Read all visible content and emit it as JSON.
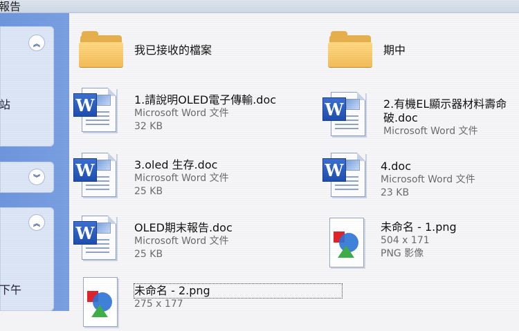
{
  "window": {
    "title_fragment": "報告"
  },
  "task_pane": {
    "panels": [
      {
        "text": "站",
        "collapse_icon": "up"
      },
      {
        "text": "",
        "collapse_icon": "down"
      },
      {
        "text": "下午",
        "collapse_icon": "up"
      }
    ]
  },
  "files": [
    {
      "type": "folder",
      "icon": "folder-icon",
      "name": "我已接收的檔案"
    },
    {
      "type": "folder",
      "icon": "folder-icon",
      "name": "期中"
    },
    {
      "type": "doc",
      "icon": "word-doc-icon",
      "name": "1.請說明OLED電子傳輸.doc",
      "kind": "Microsoft Word 文件",
      "size": "32 KB"
    },
    {
      "type": "doc",
      "icon": "word-doc-icon",
      "name": "2.有機EL顯示器材料壽命",
      "name2": "破.doc",
      "kind": "Microsoft Word 文件",
      "size": ""
    },
    {
      "type": "doc",
      "icon": "word-doc-icon",
      "name": "3.oled 生存.doc",
      "kind": "Microsoft Word 文件",
      "size": "25 KB"
    },
    {
      "type": "doc",
      "icon": "word-doc-icon",
      "name": "4.doc",
      "kind": "Microsoft Word 文件",
      "size": "23 KB"
    },
    {
      "type": "doc",
      "icon": "word-doc-icon",
      "name": "OLED期末報告.doc",
      "kind": "Microsoft Word 文件",
      "size": "25 KB"
    },
    {
      "type": "image",
      "icon": "png-image-icon",
      "name": "未命名 - 1.png",
      "kind": "504 x 171",
      "size": "PNG 影像"
    },
    {
      "type": "image",
      "icon": "png-image-icon",
      "name": "未命名 - 2.png",
      "kind": "275 x 177",
      "size": ""
    }
  ],
  "icons": {
    "word_badge": "W"
  },
  "colors": {
    "task_pane": "#7aa0e3",
    "folder": "#f3bd5a",
    "word_blue": "#2b5fc4"
  }
}
